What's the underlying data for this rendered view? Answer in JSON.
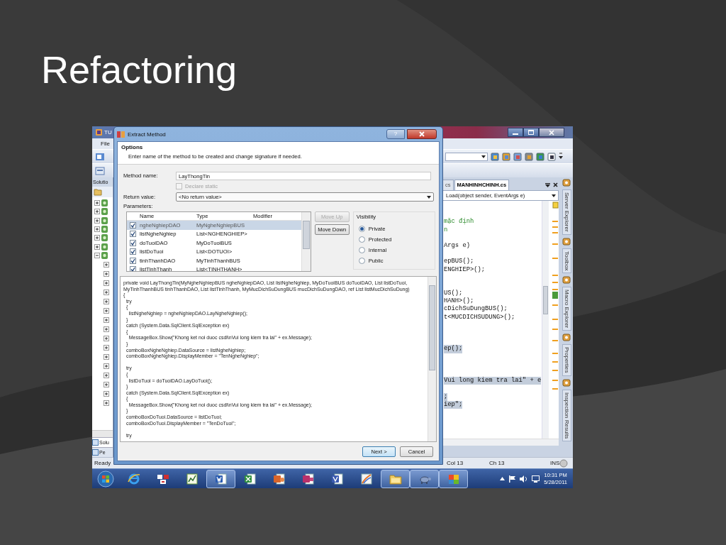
{
  "slide": {
    "title": "Refactoring"
  },
  "ide": {
    "title": "TU",
    "menu": [
      "File"
    ],
    "solution_explorer": {
      "title": "Solutio",
      "tree": [
        {
          "expanded": false
        },
        {
          "expanded": false
        },
        {
          "expanded": false
        },
        {
          "expanded": false
        },
        {
          "expanded": false
        },
        {
          "expanded": false
        },
        {
          "expanded": true,
          "children": [
            {
              "expanded": false
            },
            {
              "expanded": false
            },
            {
              "expanded": false
            },
            {
              "expanded": false
            },
            {
              "expanded": false
            },
            {
              "expanded": false
            },
            {
              "expanded": false
            },
            {
              "expanded": false
            },
            {
              "expanded": false
            },
            {
              "expanded": false
            },
            {
              "expanded": false
            },
            {
              "expanded": false
            },
            {
              "expanded": false
            },
            {
              "expanded": false
            },
            {
              "expanded": false
            },
            {
              "expanded": false
            }
          ]
        }
      ],
      "tabs": [
        {
          "label": "Solu",
          "selected": true
        },
        {
          "label": "Pe",
          "selected": false
        }
      ]
    },
    "editor": {
      "tabs": [
        {
          "label": "cs",
          "selected": false
        },
        {
          "label": "MANHINHCHINH.cs",
          "selected": true
        }
      ],
      "member_dropdown": "Load(object sender, EventArgs e)",
      "lines": [
        {
          "kind": "blank"
        },
        {
          "kind": "blank"
        },
        {
          "kind": "comment",
          "text": "mặc định",
          "highlighted": false
        },
        {
          "kind": "comment",
          "text": "n",
          "highlighted": false
        },
        {
          "kind": "blank"
        },
        {
          "kind": "code",
          "text": "Args e)",
          "highlighted": false
        },
        {
          "kind": "blank"
        },
        {
          "kind": "code",
          "text": "epBUS();",
          "highlighted": false
        },
        {
          "kind": "code",
          "text": "ENGHIEP>();",
          "highlighted": false
        },
        {
          "kind": "blank"
        },
        {
          "kind": "blank"
        },
        {
          "kind": "code",
          "text": "US();",
          "highlighted": false
        },
        {
          "kind": "code",
          "text": "HANH>();",
          "highlighted": false
        },
        {
          "kind": "code",
          "text": "cDichSuDungBUS();",
          "highlighted": false
        },
        {
          "kind": "code",
          "text": "t<MUCDICHSUDUNG>();",
          "highlighted": false
        },
        {
          "kind": "blank"
        },
        {
          "kind": "blank"
        },
        {
          "kind": "blank"
        },
        {
          "kind": "code",
          "text": "ep();",
          "highlighted": true
        },
        {
          "kind": "blank"
        },
        {
          "kind": "blank"
        },
        {
          "kind": "blank"
        },
        {
          "kind": "code",
          "text": "Vui long kiem tra lai\" + e",
          "highlighted": true
        },
        {
          "kind": "blank"
        },
        {
          "kind": "code",
          "text": ";",
          "highlighted": true
        },
        {
          "kind": "code",
          "text": "iep\";",
          "highlighted": true
        }
      ]
    },
    "side_tabs": [
      "Server Explorer",
      "Toolbox",
      "Macro Explorer",
      "Properties",
      "Inspection Results"
    ],
    "status_bar": {
      "message": "Ready",
      "column": "Col 13",
      "char": "Ch 13",
      "mode": "INS"
    }
  },
  "dialog": {
    "title": "Extract Method",
    "help": "?",
    "heading": "Options",
    "description": "Enter name of the method to be created and change signature if needed.",
    "method_name": {
      "label": "Method name:",
      "value": "LayThongTin"
    },
    "declare_static": {
      "label": "Declare static",
      "checked": false,
      "disabled": true
    },
    "return_value": {
      "label": "Return value:",
      "value": "<No return value>"
    },
    "parameters": {
      "label": "Parameters:",
      "columns": [
        "Name",
        "Type",
        "Modifier"
      ],
      "rows": [
        {
          "name": "ngheNghiepDAO",
          "type": "MyNgheNghiepBUS",
          "checked": true,
          "selected": true
        },
        {
          "name": "listNgheNghiep",
          "type": "List<NGHENGHIEP>",
          "checked": true,
          "selected": false
        },
        {
          "name": "doTuoiDAO",
          "type": "MyDoTuoiBUS",
          "checked": true,
          "selected": false
        },
        {
          "name": "listDoTuoi",
          "type": "List<DOTUOI>",
          "checked": true,
          "selected": false
        },
        {
          "name": "tinhThanhDAO",
          "type": "MyTinhThanhBUS",
          "checked": true,
          "selected": false
        },
        {
          "name": "listTinhThanh",
          "type": "List<TINHTHANH>",
          "checked": true,
          "selected": false
        }
      ]
    },
    "move_buttons": [
      {
        "label": "Move Up",
        "disabled": true
      },
      {
        "label": "Move Down",
        "disabled": false
      }
    ],
    "visibility": {
      "label": "Visibility",
      "options": [
        {
          "label": "Private",
          "selected": true
        },
        {
          "label": "Protected",
          "selected": false
        },
        {
          "label": "Internal",
          "selected": false
        },
        {
          "label": "Public",
          "selected": false
        }
      ]
    },
    "preview": "private void LayThongTin(MyNgheNghiepBUS ngheNghiepDAO, List listNgheNghiep, MyDoTuoiBUS doTuoiDAO, List listDoTuoi,\nMyTinhThanhBUS tinhThanhDAO, List listTinhThanh, MyMucDichSuDungBUS mucDichSuDungDAO, ref List listMucDichSuDung)\n{\n  try\n  {\n    listNgheNghiep = ngheNghiepDAO.LayNgheNghiep();\n  }\n  catch (System.Data.SqlClient.SqlException ex)\n  {\n    MessageBox.Show(\"Khong ket noi duoc csdl\\nVui long kiem tra lai\" + ex.Message);\n  }\n  comboBoxNgheNghiep.DataSource = listNgheNghiep;\n  comboBoxNgheNghiep.DisplayMember = \"TenNgheNghiep\";\n\n  try\n  {\n    listDoTuoi = doTuoiDAO.LayDoTuoi();\n  }\n  catch (System.Data.SqlClient.SqlException ex)\n  {\n    MessageBox.Show(\"Khong ket noi duoc csdl\\nVui long kiem tra lai\" + ex.Message);\n  }\n  comboBoxDoTuoi.DataSource = listDoTuoi;\n  comboBoxDoTuoi.DisplayMember = \"TenDoTuoi\";\n\n  try",
    "buttons": [
      {
        "label": "Next >",
        "default": true
      },
      {
        "label": "Cancel",
        "default": false
      }
    ]
  },
  "taskbar": {
    "buttons": [
      {
        "kind": "browser",
        "selected": false
      },
      {
        "kind": "grid",
        "selected": false
      },
      {
        "kind": "chart",
        "selected": false
      },
      {
        "kind": "word",
        "selected": true
      },
      {
        "kind": "excel",
        "selected": false
      },
      {
        "kind": "powerpoint",
        "selected": false
      },
      {
        "kind": "access",
        "selected": false
      },
      {
        "kind": "visio",
        "selected": false
      },
      {
        "kind": "swoosh",
        "selected": false
      },
      {
        "kind": "folder",
        "selected": true
      },
      {
        "kind": "turtle",
        "selected": true
      },
      {
        "kind": "puzzle",
        "selected": true
      }
    ],
    "clock": {
      "time": "10:31 PM",
      "date": "5/28/2011"
    }
  }
}
